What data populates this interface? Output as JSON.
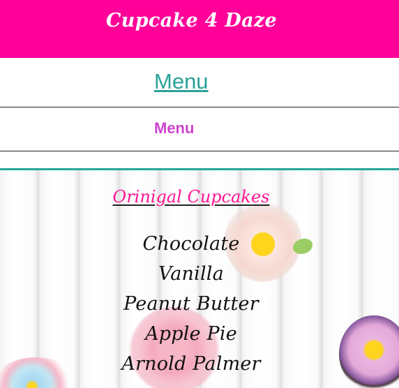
{
  "header": {
    "brand": "Cupcake 4 Daze",
    "background": "#ff0099"
  },
  "nav": {
    "menu_link": "Menu"
  },
  "subheader": {
    "title": "Menu"
  },
  "hero": {
    "section_title": "Orinigal Cupcakes",
    "items": [
      "Chocolate",
      "Vanilla",
      "Peanut Butter",
      "Apple Pie",
      "Arnold Palmer"
    ]
  },
  "colors": {
    "accent_teal": "#26a69a",
    "pink": "#ff1493",
    "magenta": "#cc44cc"
  }
}
